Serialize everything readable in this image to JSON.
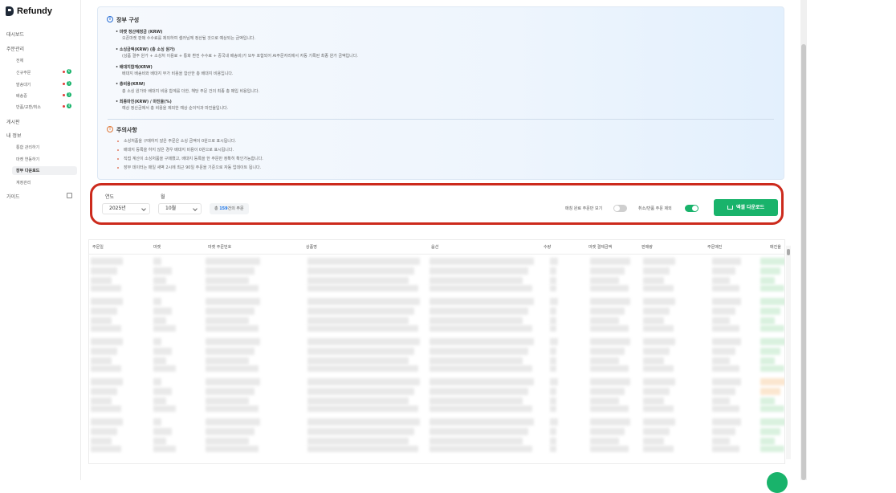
{
  "app": {
    "name": "Refundy"
  },
  "sidebar": {
    "dashboard": "대시보드",
    "order_mgmt": "주문관리",
    "order_all": "전체",
    "order_new": "신규주문",
    "order_ship": "발송대기",
    "order_delivered": "배송중",
    "order_return": "반품/교환/취소",
    "board": "게시판",
    "my_info": "내 정보",
    "my_sub1": "통합 관리하기",
    "my_sub2": "마켓 연동하기",
    "my_sub3": "장부 다운로드",
    "my_sub4": "계정관리",
    "guide": "가이드",
    "badges": [
      "6",
      "1",
      "1",
      "4"
    ]
  },
  "info": {
    "title": "장부 구성",
    "items": [
      {
        "term": "• 마켓 정산예정금 (KRW)",
        "desc": "오픈마켓 판매 수수료를 제외하여 셀러님께 정산될 것으로 예상되는 금액입니다."
      },
      {
        "term": "• 소싱금액(KRW) (총 소싱 원가)",
        "desc": "(상품 결주 원가 + 소싱처 이용료 + 통화 환전 수수료 + 중국내 배송비)가 모두 포함되어 AI주문자리에서 자동 기록된 최종 원가 금액입니다."
      },
      {
        "term": "• 배대지합계(KRW)",
        "desc": "배대지 배송비와 배대지 부가 비용을 합산한 총 배대지 비용입니다."
      },
      {
        "term": "• 총비용(KRW)",
        "desc": "총 소싱 원가와 배대지 비용 합계를 더한, 해당 주문 건의 최종 총 매입 비용입니다."
      },
      {
        "term": "• 최종마진(KRW) / 마진율(%)",
        "desc": "예상 정산금에서 총 비용을 제외한 예상 순이익과 마진율입니다."
      }
    ],
    "caution_title": "주의사항",
    "cautions": [
      "소싱처품을 구매하지 않은 주문은 소싱 금액이 0원으로 표시됩니다.",
      "배대지 등록을 하지 않은 경우 배대지 비용이 0원으로 표시됩니다.",
      "직접 계산이 소싱처품을 구매했고, 배대지 등록을 한 주문만 정확히 확인가능합니다.",
      "장부 데이터는 매일 새벽 2시에 최근 90일 주문을 기준으로 자동 업데이트 됩니다."
    ]
  },
  "filters": {
    "year_label": "연도",
    "year_value": "2025년",
    "month_label": "월",
    "month_value": "10월",
    "count_prefix": "총 ",
    "count_number": "159",
    "count_suffix": "건의 주문",
    "toggle1_label": "매칭 완료 주문만 보기",
    "toggle1_on": false,
    "toggle2_label": "취소/반품 주문 제외",
    "toggle2_on": true,
    "download_label": "엑셀 다운로드"
  },
  "table": {
    "headers": [
      "주문일",
      "마켓",
      "마켓 주문번호",
      "상품명",
      "옵션",
      "수량",
      "마켓 결제금액",
      "판매량",
      "주문매진",
      "매진율"
    ]
  },
  "colors": {
    "accent": "#19b36b",
    "highlight": "#cc2a1c",
    "link": "#1a73e8"
  }
}
